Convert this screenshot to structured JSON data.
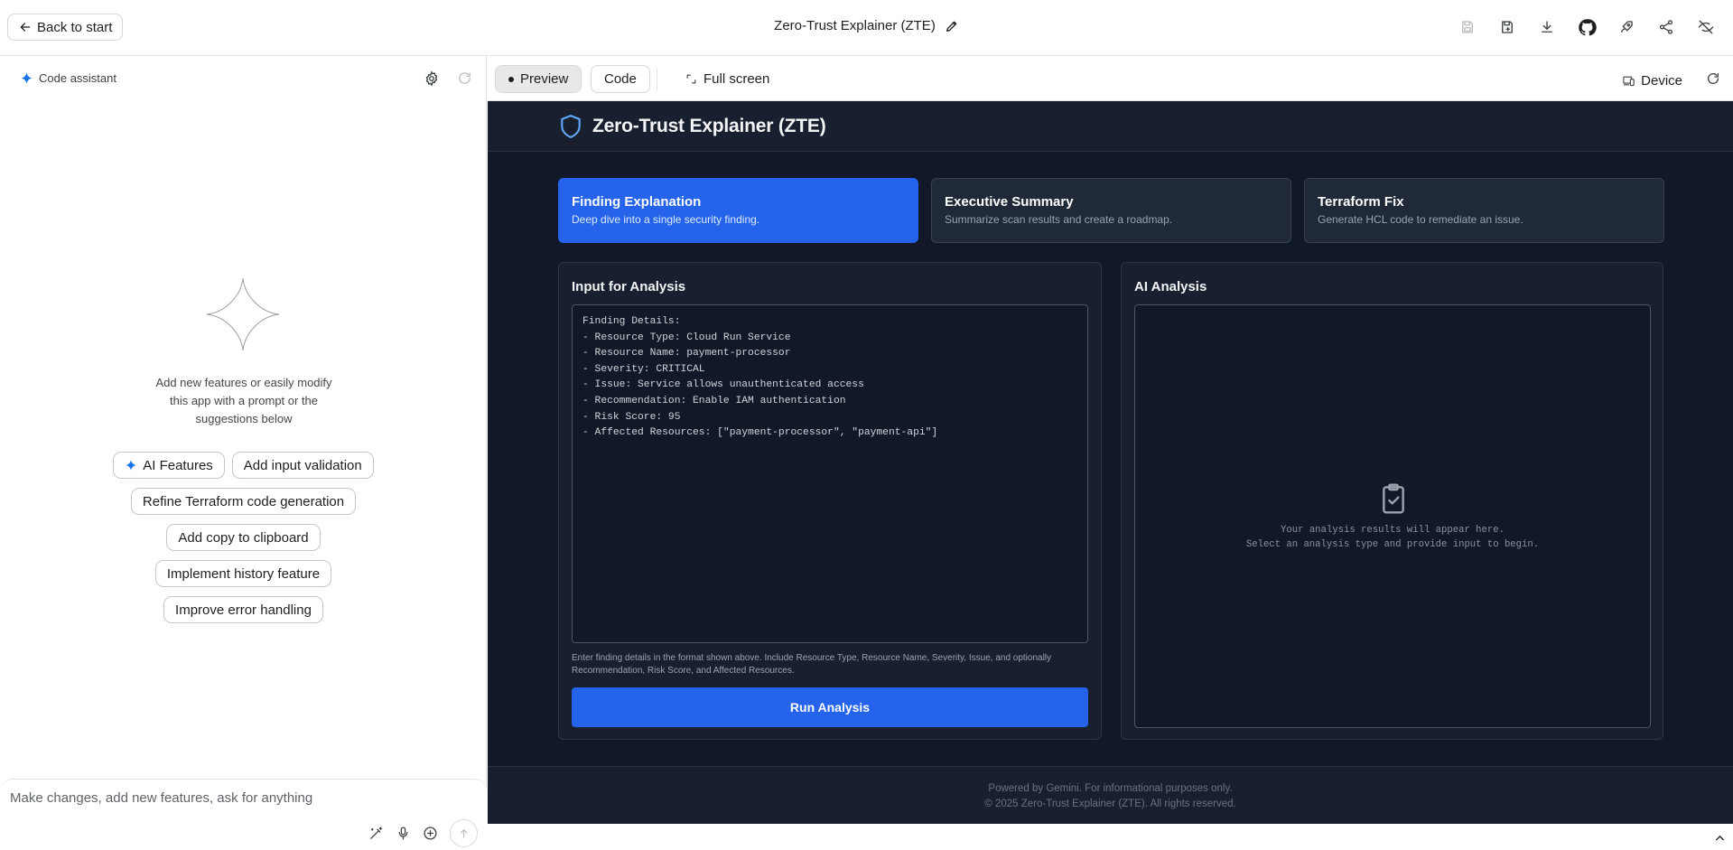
{
  "topbar": {
    "back_label": "Back to start",
    "app_title": "Zero-Trust Explainer (ZTE)",
    "actions": [
      "save-icon",
      "save-copy-icon",
      "download-icon",
      "github-icon",
      "deploy-rocket-icon",
      "share-icon",
      "hide-icon"
    ]
  },
  "assistant": {
    "title": "Code assistant",
    "hint": "Add new features or easily modify this app with a prompt or the suggestions below",
    "chips": [
      "AI Features",
      "Add input validation",
      "Refine Terraform code generation",
      "Add copy to clipboard",
      "Implement history feature",
      "Improve error handling"
    ],
    "prompt_placeholder": "Make changes, add new features, ask for anything"
  },
  "preview_toolbar": {
    "preview_label": "Preview",
    "code_label": "Code",
    "fullscreen_label": "Full screen",
    "device_label": "Device"
  },
  "app": {
    "header_title": "Zero-Trust Explainer (ZTE)",
    "modes": [
      {
        "title": "Finding Explanation",
        "desc": "Deep dive into a single security finding.",
        "active": true
      },
      {
        "title": "Executive Summary",
        "desc": "Summarize scan results and create a roadmap.",
        "active": false
      },
      {
        "title": "Terraform Fix",
        "desc": "Generate HCL code to remediate an issue.",
        "active": false
      }
    ],
    "input_panel": {
      "title": "Input for Analysis",
      "value": "Finding Details:\n- Resource Type: Cloud Run Service\n- Resource Name: payment-processor\n- Severity: CRITICAL\n- Issue: Service allows unauthenticated access\n- Recommendation: Enable IAM authentication\n- Risk Score: 95\n- Affected Resources: [\"payment-processor\", \"payment-api\"]",
      "help": "Enter finding details in the format shown above. Include Resource Type, Resource Name, Severity, Issue, and optionally Recommendation, Risk Score, and Affected Resources.",
      "button": "Run Analysis"
    },
    "output_panel": {
      "title": "AI Analysis",
      "empty_line1": "Your analysis results will appear here.",
      "empty_line2": "Select an analysis type and provide input to begin."
    },
    "footer": {
      "line1": "Powered by Gemini. For informational purposes only.",
      "line2": "© 2025 Zero-Trust Explainer (ZTE). All rights reserved."
    }
  },
  "colors": {
    "accent_blue": "#2563eb",
    "app_bg": "#111827",
    "panel_bg": "#18202f",
    "gemini_blue": "#1a73e8"
  }
}
